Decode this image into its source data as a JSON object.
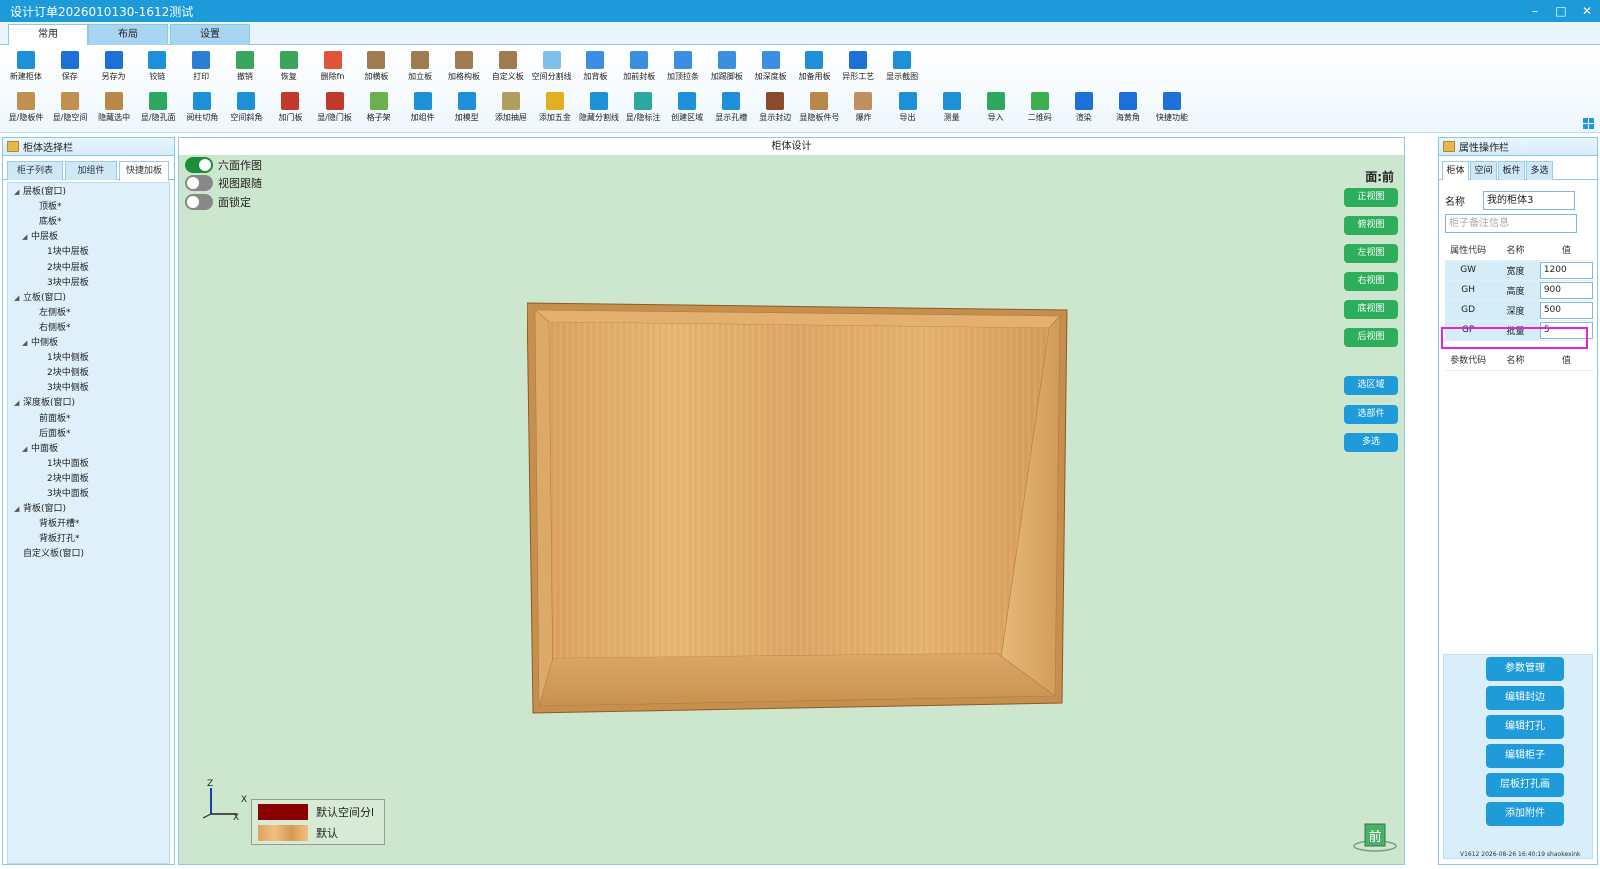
{
  "window": {
    "title": "设计订单2026010130-1612测试",
    "controls": [
      "–",
      "□",
      "✕"
    ]
  },
  "ribbon_tabs": [
    "常用",
    "布局",
    "设置"
  ],
  "toolbar": {
    "row1": [
      {
        "label": "新建柜体",
        "icon": "new-cabinet-icon",
        "color": "#1e90d8"
      },
      {
        "label": "保存",
        "icon": "save-icon",
        "color": "#1e6fd8"
      },
      {
        "label": "另存为",
        "icon": "save-as-icon",
        "color": "#1e6fd8"
      },
      {
        "label": "铰链",
        "icon": "hinge-icon",
        "color": "#1e90d8"
      },
      {
        "label": "打印",
        "icon": "print-icon",
        "color": "#2a7fd4"
      },
      {
        "label": "撤销",
        "icon": "undo-icon",
        "color": "#3ca55c"
      },
      {
        "label": "恢复",
        "icon": "redo-icon",
        "color": "#3ca55c"
      },
      {
        "label": "删除fn",
        "icon": "delete-icon",
        "color": "#e0553a"
      },
      {
        "label": "加横板",
        "icon": "add-horizontal-board-icon",
        "color": "#a07a50"
      },
      {
        "label": "加立板",
        "icon": "add-vertical-board-icon",
        "color": "#a07a50"
      },
      {
        "label": "加格构板",
        "icon": "add-grid-board-icon",
        "color": "#a07a50"
      },
      {
        "label": "自定义板",
        "icon": "custom-board-icon",
        "color": "#a07a50"
      },
      {
        "label": "空间分割线",
        "icon": "space-divider-icon",
        "color": "#7fc0e8"
      },
      {
        "label": "加背板",
        "icon": "add-back-board-icon",
        "color": "#3a8fe0"
      },
      {
        "label": "加前封板",
        "icon": "add-front-seal-icon",
        "color": "#3a8fe0"
      },
      {
        "label": "加顶拉条",
        "icon": "add-top-strip-icon",
        "color": "#3a8fe0"
      },
      {
        "label": "加踢脚板",
        "icon": "add-kickboard-icon",
        "color": "#3a8fe0"
      },
      {
        "label": "加深度板",
        "icon": "add-depth-board-icon",
        "color": "#3a8fe0"
      },
      {
        "label": "加备用板",
        "icon": "add-spare-board-icon",
        "color": "#1e90d8"
      },
      {
        "label": "异形工艺",
        "icon": "special-craft-icon",
        "color": "#1e6fd8"
      },
      {
        "label": "显示截图",
        "icon": "show-screenshot-icon",
        "color": "#1e90d8"
      }
    ],
    "row2": [
      {
        "label": "显/隐板件",
        "icon": "toggle-panels-icon",
        "color": "#c09050"
      },
      {
        "label": "显/隐空间",
        "icon": "toggle-space-icon",
        "color": "#c09050"
      },
      {
        "label": "隐藏选中",
        "icon": "hide-selected-icon",
        "color": "#b88848"
      },
      {
        "label": "显/隐孔面",
        "icon": "toggle-hole-face-icon",
        "color": "#2ca860"
      },
      {
        "label": "阅柱切角",
        "icon": "column-chamfer-icon",
        "color": "#1e90d8"
      },
      {
        "label": "空间斜角",
        "icon": "space-bevel-icon",
        "color": "#1e90d8"
      },
      {
        "label": "加门板",
        "icon": "add-door-icon",
        "color": "#c0392b"
      },
      {
        "label": "显/隐门板",
        "icon": "toggle-door-icon",
        "color": "#c0392b"
      },
      {
        "label": "格子架",
        "icon": "grid-rack-icon",
        "color": "#6ab04c"
      },
      {
        "label": "加组件",
        "icon": "add-component-icon",
        "color": "#1e90d8"
      },
      {
        "label": "加模型",
        "icon": "add-model-icon",
        "color": "#1e90d8"
      },
      {
        "label": "添加抽屉",
        "icon": "add-drawer-icon",
        "color": "#b0a060"
      },
      {
        "label": "添加五金",
        "icon": "add-hardware-icon",
        "color": "#e0b020"
      },
      {
        "label": "隐藏分割线",
        "icon": "hide-divider-icon",
        "color": "#1e90d8"
      },
      {
        "label": "显/隐标注",
        "icon": "toggle-annotation-icon",
        "color": "#2ca8a0"
      },
      {
        "label": "创建区域",
        "icon": "create-region-icon",
        "color": "#1e90d8"
      },
      {
        "label": "显示孔槽",
        "icon": "show-holes-icon",
        "color": "#1e90d8"
      },
      {
        "label": "显示封边",
        "icon": "show-edge-icon",
        "color": "#8b4a2b"
      },
      {
        "label": "显隐板件号",
        "icon": "toggle-panel-number-icon",
        "color": "#b88848"
      },
      {
        "label": "爆炸",
        "icon": "explode-icon",
        "color": "#c09060"
      },
      {
        "label": "导出",
        "icon": "export-icon",
        "color": "#1e90d8"
      },
      {
        "label": "测量",
        "icon": "measure-icon",
        "color": "#1e90d8"
      },
      {
        "label": "导入",
        "icon": "import-icon",
        "color": "#2ca860"
      },
      {
        "label": "二维码",
        "icon": "qrcode-icon",
        "color": "#3cb050"
      },
      {
        "label": "渲染",
        "icon": "render-icon",
        "color": "#1e6fd8"
      },
      {
        "label": "海黄角",
        "icon": "corner-icon",
        "color": "#1e6fd8"
      },
      {
        "label": "快捷功能",
        "icon": "quick-function-icon",
        "color": "#1e6fd8"
      }
    ]
  },
  "left_panel": {
    "title": "柜体选择栏",
    "tabs": [
      "柜子列表",
      "加组件",
      "快捷加板"
    ],
    "active_tab": 2,
    "tree": [
      {
        "label": "层板(窗口)",
        "level": 0,
        "expand": true
      },
      {
        "label": "顶板*",
        "level": 2,
        "expand": false
      },
      {
        "label": "底板*",
        "level": 2,
        "expand": false
      },
      {
        "label": "中层板",
        "level": 1,
        "expand": true
      },
      {
        "label": "1块中层板",
        "level": 3,
        "expand": false
      },
      {
        "label": "2块中层板",
        "level": 3,
        "expand": false
      },
      {
        "label": "3块中层板",
        "level": 3,
        "expand": false
      },
      {
        "label": "立板(窗口)",
        "level": 0,
        "expand": true
      },
      {
        "label": "左侧板*",
        "level": 2,
        "expand": false
      },
      {
        "label": "右侧板*",
        "level": 2,
        "expand": false
      },
      {
        "label": "中侧板",
        "level": 1,
        "expand": true
      },
      {
        "label": "1块中侧板",
        "level": 3,
        "expand": false
      },
      {
        "label": "2块中侧板",
        "level": 3,
        "expand": false
      },
      {
        "label": "3块中侧板",
        "level": 3,
        "expand": false
      },
      {
        "label": "深度板(窗口)",
        "level": 0,
        "expand": true
      },
      {
        "label": "前面板*",
        "level": 2,
        "expand": false
      },
      {
        "label": "后面板*",
        "level": 2,
        "expand": false
      },
      {
        "label": "中面板",
        "level": 1,
        "expand": true
      },
      {
        "label": "1块中面板",
        "level": 3,
        "expand": false
      },
      {
        "label": "2块中面板",
        "level": 3,
        "expand": false
      },
      {
        "label": "3块中面板",
        "level": 3,
        "expand": false
      },
      {
        "label": "背板(窗口)",
        "level": 0,
        "expand": true
      },
      {
        "label": "背板开槽*",
        "level": 2,
        "expand": false
      },
      {
        "label": "背板打孔*",
        "level": 2,
        "expand": false
      },
      {
        "label": "自定义板(窗口)",
        "level": 0,
        "expand": false
      }
    ]
  },
  "canvas": {
    "title": "柜体设计",
    "toggles": [
      {
        "label": "六面作图",
        "on": true
      },
      {
        "label": "视图跟随",
        "on": false
      },
      {
        "label": "面锁定",
        "on": false
      }
    ],
    "face_label": "面:前",
    "view_buttons": [
      "正视图",
      "俯视图",
      "左视图",
      "右视图",
      "底视图",
      "后视图"
    ],
    "select_buttons": [
      "选区域",
      "选部件",
      "多选"
    ],
    "legend": [
      {
        "label": "默认空间分l",
        "color": "#8b0000"
      },
      {
        "label": "默认",
        "color": "#e0a060"
      }
    ],
    "axis": {
      "z": "Z",
      "x": "X",
      "x2": "X"
    },
    "face_cube_label": "前",
    "colors": {
      "wood_light": "#e8b874",
      "wood_dark": "#c48a44",
      "canvas_bg": "#cde7ce",
      "view_btn": "#2cae5b",
      "select_btn": "#1e9bd8"
    }
  },
  "right_panel": {
    "title": "属性操作栏",
    "tabs": [
      "柜体",
      "空间",
      "板件",
      "多选"
    ],
    "name_label": "名称",
    "name_value": "我的柜体3",
    "note_placeholder": "柜子备注信息",
    "prop_header": [
      "属性代码",
      "名称",
      "值"
    ],
    "props": [
      {
        "code": "GW",
        "name": "宽度",
        "value": "1200"
      },
      {
        "code": "GH",
        "name": "高度",
        "value": "900"
      },
      {
        "code": "GD",
        "name": "深度",
        "value": "500"
      },
      {
        "code": "GP",
        "name": "批量",
        "value": "5"
      }
    ],
    "param_header": [
      "参数代码",
      "名称",
      "值"
    ],
    "buttons": [
      "参数管理",
      "编辑封边",
      "编辑打孔",
      "编辑柜子",
      "层板打孔画",
      "添加附件"
    ],
    "version": "V1612 2026-08-26 16:40:19 shaokexink"
  }
}
